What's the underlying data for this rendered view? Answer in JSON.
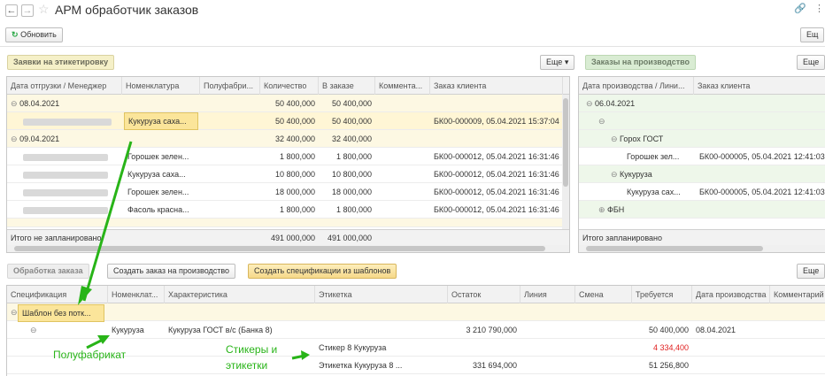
{
  "window": {
    "title": "АРМ обработчик заказов",
    "refresh_label": "Обновить",
    "more_label": "Ещ"
  },
  "orders": {
    "tab_label": "Заявки на этикетировку",
    "more_label": "Еще",
    "columns": [
      "Дата отгрузки / Менеджер",
      "Номенклатура",
      "Полуфабри...",
      "Количество",
      "В заказе",
      "Коммента...",
      "Заказ клиента"
    ],
    "rows": [
      {
        "type": "group",
        "date": "08.04.2021",
        "qty": "50 400,000",
        "in_order": "50 400,000"
      },
      {
        "type": "item",
        "item": "Кукуруза саха...",
        "qty": "50 400,000",
        "in_order": "50 400,000",
        "client_order": "БК00-000009, 05.04.2021 15:37:04",
        "highlight": true
      },
      {
        "type": "group",
        "date": "09.04.2021",
        "qty": "32 400,000",
        "in_order": "32 400,000"
      },
      {
        "type": "item",
        "item": "Горошек зелен...",
        "qty": "1 800,000",
        "in_order": "1 800,000",
        "client_order": "БК00-000012, 05.04.2021 16:31:46"
      },
      {
        "type": "item",
        "item": "Кукуруза саха...",
        "qty": "10 800,000",
        "in_order": "10 800,000",
        "client_order": "БК00-000012, 05.04.2021 16:31:46"
      },
      {
        "type": "item",
        "item": "Горошек зелен...",
        "qty": "18 000,000",
        "in_order": "18 000,000",
        "client_order": "БК00-000012, 05.04.2021 16:31:46"
      },
      {
        "type": "item",
        "item": "Фасоль красна...",
        "qty": "1 800,000",
        "in_order": "1 800,000",
        "client_order": "БК00-000012, 05.04.2021 16:31:46"
      }
    ],
    "footer_label": "Итого не запланировано",
    "footer_qty": "491 000,000",
    "footer_in_order": "491 000,000"
  },
  "production": {
    "tab_label": "Заказы на производство",
    "more_label": "Еще",
    "columns": [
      "Дата производства / Лини...",
      "Заказ клиента"
    ],
    "rows": [
      {
        "level": 0,
        "label": "06.04.2021",
        "client_order": ""
      },
      {
        "level": 1,
        "label": "",
        "client_order": ""
      },
      {
        "level": 2,
        "label": "Горох ГОСТ",
        "client_order": ""
      },
      {
        "level": 3,
        "label": "Горошек зел...",
        "client_order": "БК00-000005, 05.04.2021 12:41:03"
      },
      {
        "level": 2,
        "label": "Кукуруза",
        "client_order": ""
      },
      {
        "level": 3,
        "label": "Кукуруза сах...",
        "client_order": "БК00-000005, 05.04.2021 12:41:03"
      },
      {
        "level": 2,
        "label": "ФБН",
        "client_order": ""
      }
    ],
    "footer_label": "Итого запланировано"
  },
  "processing": {
    "tab_label": "Обработка заказа",
    "create_order_label": "Создать заказ на производство",
    "create_specs_label": "Создать спецификации из шаблонов",
    "more_label": "Еще",
    "columns": [
      "Спецификация",
      "Номенклат...",
      "Характеристика",
      "Этикетка",
      "Остаток",
      "Линия",
      "Смена",
      "Требуется",
      "Дата производства",
      "Комментарий"
    ],
    "rows": [
      {
        "spec": "Шаблон без потк...",
        "item": "",
        "characteristic": "",
        "label": "",
        "stock": "",
        "required": "",
        "date": ""
      },
      {
        "spec": "",
        "item": "Кукуруза",
        "characteristic": "Кукуруза ГОСТ в/с (Банка 8)",
        "label": "",
        "stock": "3 210 790,000",
        "required": "50 400,000",
        "date": "08.04.2021"
      },
      {
        "spec": "",
        "item": "",
        "characteristic": "",
        "label": "Стикер 8 Кукуруза",
        "stock": "",
        "required": "4 334,400",
        "date": ""
      },
      {
        "spec": "",
        "item": "",
        "characteristic": "",
        "label": "Этикетка Кукуруза 8 ...",
        "stock": "331 694,000",
        "required": "51 256,800",
        "date": ""
      }
    ]
  },
  "annotations": {
    "semi_finished": "Полуфабрикат",
    "stickers_line1": "Стикеры и",
    "stickers_line2": "этикетки"
  },
  "colors": {
    "annotation": "#28b418",
    "warning": "#e02020",
    "highlight": "#fbe59a"
  }
}
